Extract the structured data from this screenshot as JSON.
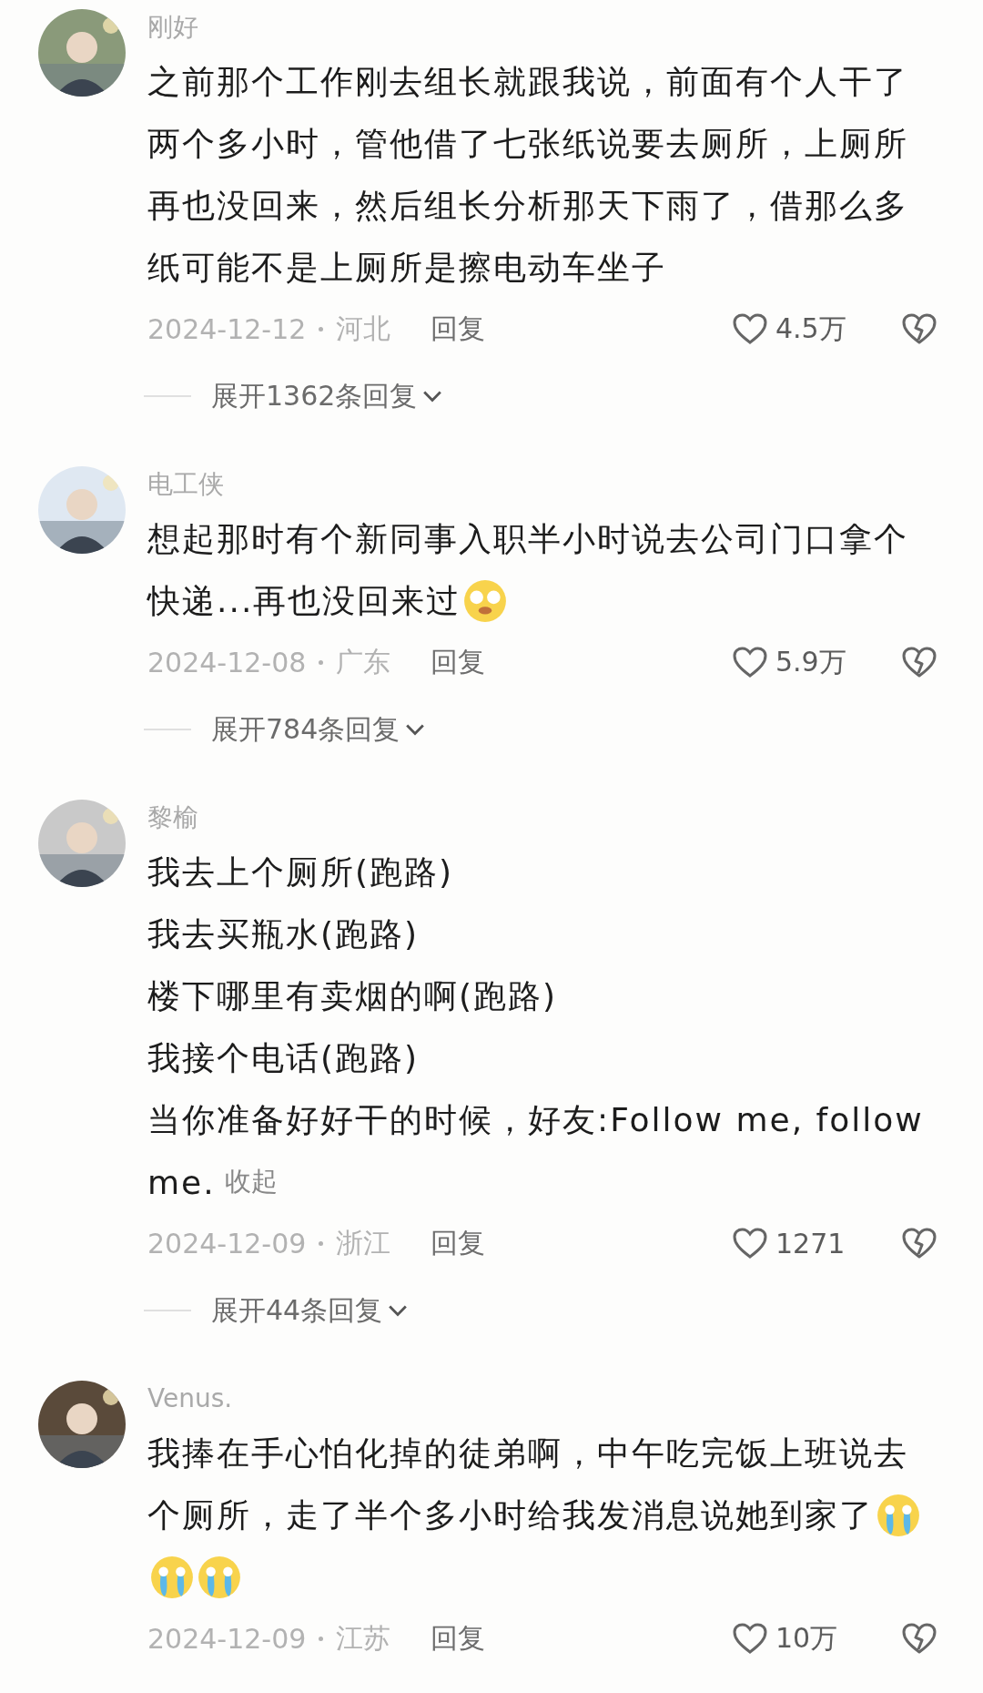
{
  "comments": [
    {
      "name": "刚好",
      "avatar": {
        "kind": "picture"
      },
      "lines": [
        {
          "text": "之前那个工作刚去组长就跟我说，前面有个人干了"
        },
        {
          "text": "两个多小时，管他借了七张纸说要去厕所，上厕所"
        },
        {
          "text": "再也没回来，然后组长分析那天下雨了，借那么多"
        },
        {
          "text": "纸可能不是上厕所是擦电动车坐子"
        }
      ],
      "date": "2024-12-12",
      "region": "河北",
      "reply": "回复",
      "likes": "4.5万",
      "expand": "展开1362条回复"
    },
    {
      "name": "电工侠",
      "avatar": {
        "kind": "picture"
      },
      "lines": [
        {
          "text": "想起那时有个新同事入职半小时说去公司门口拿个"
        },
        {
          "text": "快递...再也没回来过",
          "emojis": [
            {
              "kind": "pleading"
            }
          ]
        }
      ],
      "date": "2024-12-08",
      "region": "广东",
      "reply": "回复",
      "likes": "5.9万",
      "expand": "展开784条回复"
    },
    {
      "name": "黎榆",
      "avatar": {
        "kind": "picture"
      },
      "lines": [
        {
          "text": "我去上个厕所(跑路)"
        },
        {
          "text": "我去买瓶水(跑路)"
        },
        {
          "text": "楼下哪里有卖烟的啊(跑路)"
        },
        {
          "text": "我接个电话(跑路)"
        },
        {
          "text": "当你准备好好干的时候，好友:Follow me, follow"
        },
        {
          "text": "me.",
          "link": "收起"
        }
      ],
      "date": "2024-12-09",
      "region": "浙江",
      "reply": "回复",
      "likes": "1271",
      "expand": "展开44条回复"
    },
    {
      "name": "Venus.",
      "avatar": {
        "kind": "picture"
      },
      "lines": [
        {
          "text": "我捧在手心怕化掉的徒弟啊，中午吃完饭上班说去"
        },
        {
          "text": "个厕所，走了半个多小时给我发消息说她到家了",
          "emojis": [
            {
              "kind": "crying"
            }
          ]
        },
        {
          "emojis": [
            {
              "kind": "crying"
            },
            {
              "kind": "crying"
            }
          ]
        }
      ],
      "date": "2024-12-09",
      "region": "江苏",
      "reply": "回复",
      "likes": "10万"
    }
  ]
}
